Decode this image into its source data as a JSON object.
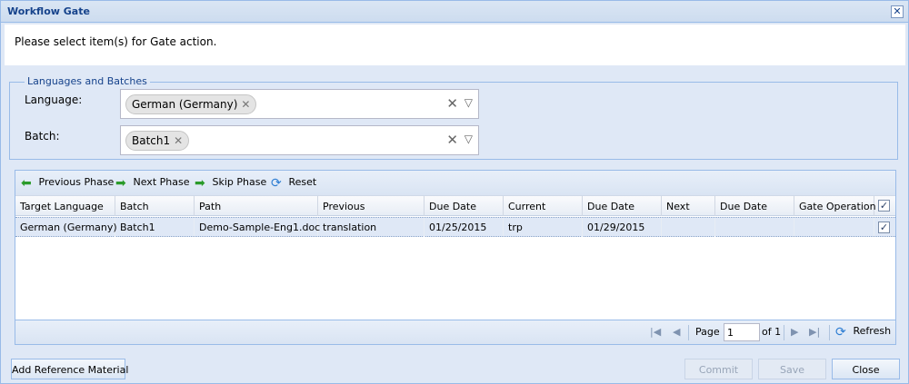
{
  "window": {
    "title": "Workflow Gate",
    "close_glyph": "✕"
  },
  "prompt": "Please select item(s) for Gate action.",
  "fieldset": {
    "legend": "Languages and Batches",
    "language_label": "Language:",
    "language_value": "German (Germany)",
    "batch_label": "Batch:",
    "batch_value": "Batch1"
  },
  "toolbar": {
    "previous_phase": "Previous Phase",
    "next_phase": "Next Phase",
    "skip_phase": "Skip Phase",
    "reset": "Reset"
  },
  "grid": {
    "columns": [
      "Target Language",
      "Batch",
      "Path",
      "Previous",
      "Due Date",
      "Current",
      "Due Date",
      "Next",
      "Due Date",
      "Gate Operation"
    ],
    "header_checked": true,
    "rows": [
      {
        "cells": [
          "German (Germany)",
          "Batch1",
          "Demo-Sample-Eng1.doc",
          "translation",
          "01/25/2015",
          "trp",
          "01/29/2015",
          "",
          "",
          ""
        ],
        "checked": true
      }
    ]
  },
  "pager": {
    "page_label": "Page",
    "page_value": "1",
    "of_label": "of 1",
    "refresh": "Refresh"
  },
  "buttons": {
    "add_reference": "Add Reference Material",
    "commit": "Commit",
    "save": "Save",
    "close": "Close"
  },
  "colors": {
    "accent": "#15428b",
    "border": "#99bbe8",
    "background": "#dfe8f6"
  }
}
